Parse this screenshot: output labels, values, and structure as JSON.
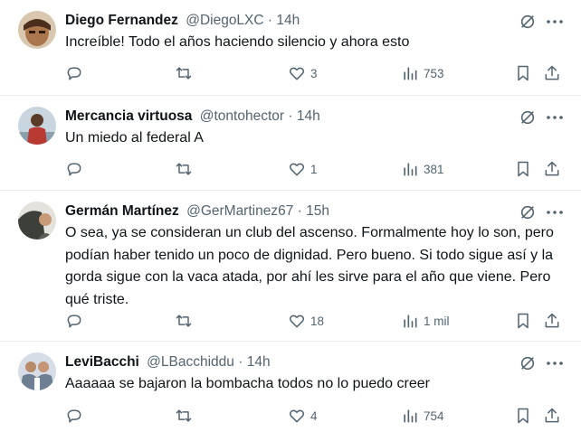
{
  "tweets": [
    {
      "name": "Diego Fernandez",
      "handle": "@DiegoLXC",
      "separator": "·",
      "time": "14h",
      "text_lines": [
        "Increíble! Todo el años haciendo silencio y ahora esto"
      ],
      "replies": "",
      "retweets": "",
      "likes": "3",
      "views": "753",
      "avatar_color": "#7a5230"
    },
    {
      "name": "Mercancia virtuosa",
      "handle": "@tontohector",
      "separator": "·",
      "time": "14h",
      "text_lines": [
        "Un miedo al federal A"
      ],
      "replies": "",
      "retweets": "",
      "likes": "1",
      "views": "381",
      "avatar_color": "#b93a32"
    },
    {
      "name": "Germán Martínez",
      "handle": "@GerMartinez67",
      "separator": "·",
      "time": "15h",
      "text_lines": [
        "O sea, ya se consideran un club del ascenso. Formalmente hoy lo son, pero",
        "podían haber tenido un poco de dignidad. Pero bueno. Si todo sigue así y la",
        "gorda sigue con la vaca atada, por ahí les sirve para el año que viene. Pero",
        "qué triste."
      ],
      "replies": "",
      "retweets": "",
      "likes": "18",
      "views": "1 mil",
      "avatar_color": "#3d3f3a"
    },
    {
      "name": "LeviBacchi",
      "handle": "@LBacchiddu",
      "separator": "·",
      "time": "14h",
      "text_lines": [
        "Aaaaaa se bajaron la bombacha todos no lo puedo creer"
      ],
      "replies": "",
      "retweets": "",
      "likes": "4",
      "views": "754",
      "avatar_color": "#6f7f93"
    }
  ],
  "icons": {
    "grok": "grok-icon",
    "more": "more-icon",
    "reply": "reply-icon",
    "retweet": "retweet-icon",
    "like": "like-icon",
    "views": "views-icon",
    "bookmark": "bookmark-icon",
    "share": "share-icon"
  },
  "colors": {
    "text": "#0f1419",
    "secondary": "#536471",
    "divider": "#e7ebee"
  }
}
